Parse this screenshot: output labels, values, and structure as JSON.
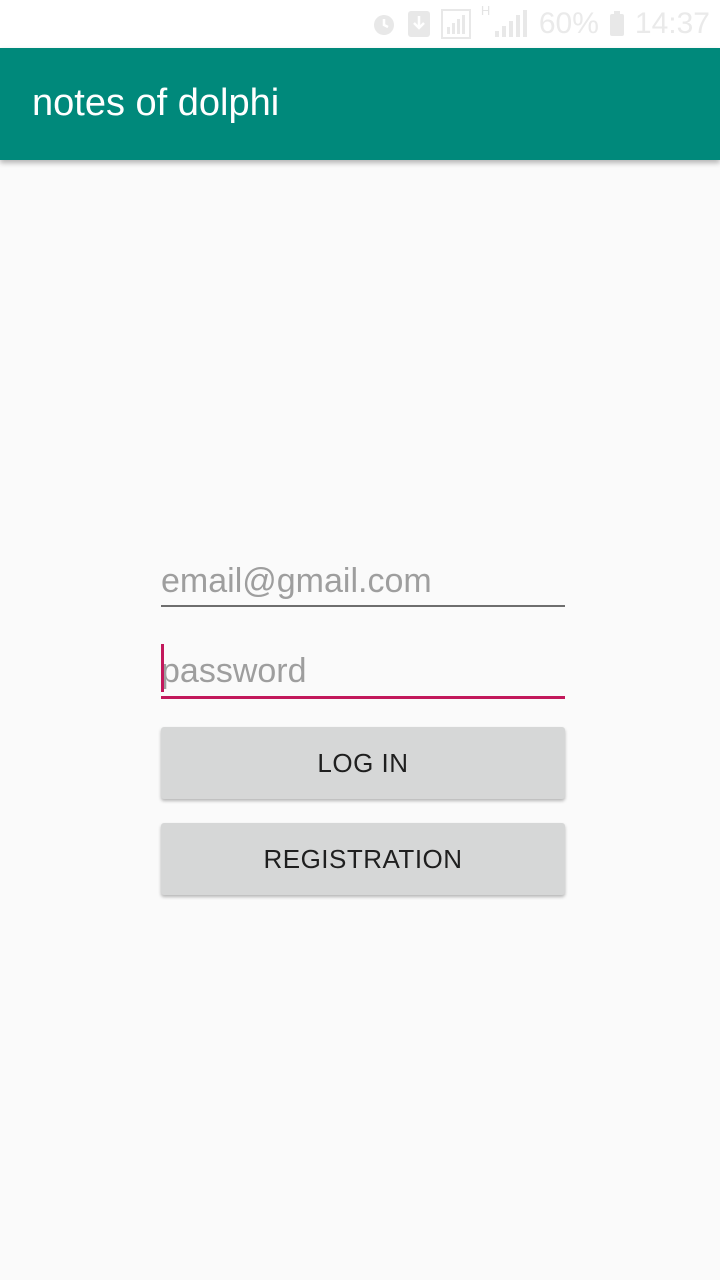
{
  "status_bar": {
    "battery_text": "60%",
    "time": "14:37",
    "network_label": "H",
    "icons": [
      "alarm-icon",
      "download-icon",
      "signal-box-icon",
      "cellular-signal-icon",
      "battery-icon"
    ]
  },
  "app_bar": {
    "title": "notes of dolphi",
    "color": "#00897b"
  },
  "form": {
    "email": {
      "placeholder": "email@gmail.com",
      "value": ""
    },
    "password": {
      "placeholder": "password",
      "value": "",
      "focused": true
    },
    "login_label": "LOG IN",
    "registration_label": "REGISTRATION"
  },
  "colors": {
    "accent": "#c2185b",
    "button_bg": "#d6d7d7",
    "background": "#fafafa"
  }
}
